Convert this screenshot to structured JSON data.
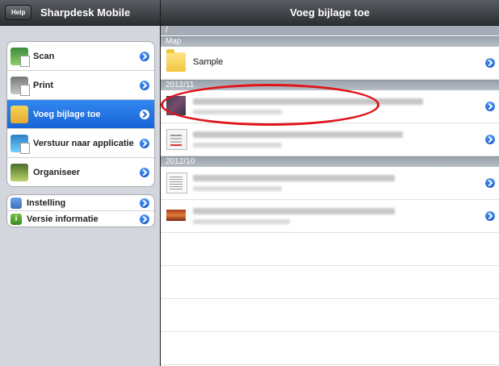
{
  "left_panel": {
    "help_label": "Help",
    "app_title": "Sharpdesk Mobile",
    "menu_items": [
      {
        "label": "Scan",
        "icon": "scan-icon"
      },
      {
        "label": "Print",
        "icon": "print-icon"
      },
      {
        "label": "Voeg bijlage toe",
        "icon": "attach-mail-icon",
        "selected": true
      },
      {
        "label": "Verstuur naar applicatie",
        "icon": "send-to-app-icon"
      },
      {
        "label": "Organiseer",
        "icon": "organize-icon"
      }
    ],
    "settings_items": [
      {
        "label": "Instelling",
        "icon": "gear-icon"
      },
      {
        "label": "Versie informatie",
        "icon": "info-icon"
      }
    ]
  },
  "right_panel": {
    "title": "Voeg bijlage toe",
    "path": "/",
    "sections": [
      {
        "header": "Map",
        "rows": [
          {
            "name": "Sample",
            "icon": "folder-icon"
          }
        ]
      },
      {
        "header": "2012/11",
        "rows": [
          {
            "name": "",
            "icon": "photo-thumbnail",
            "blurred": true
          },
          {
            "name": "",
            "icon": "document-thumbnail",
            "blurred": true
          }
        ]
      },
      {
        "header": "2012/10",
        "rows": [
          {
            "name": "",
            "icon": "text-document-thumbnail",
            "blurred": true
          },
          {
            "name": "",
            "icon": "image-thumbnail",
            "blurred": true
          }
        ]
      }
    ]
  },
  "colors": {
    "accent": "#1a6fe0",
    "highlight_oval": "#e0141b",
    "toolbar": "#3b3d42"
  }
}
